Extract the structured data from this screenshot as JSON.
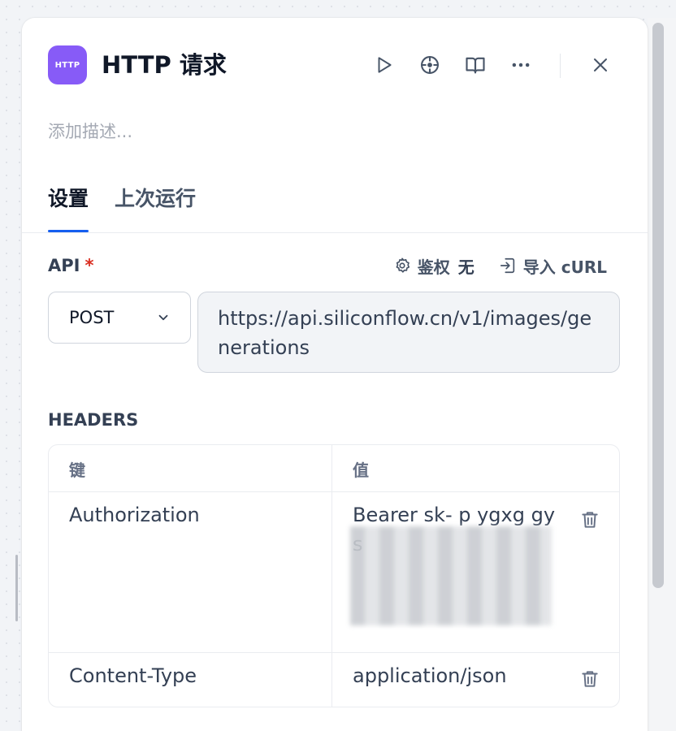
{
  "node": {
    "icon_label": "HTTP",
    "title": "HTTP 请求",
    "description_placeholder": "添加描述..."
  },
  "header_actions": [
    "play-icon",
    "locate-icon",
    "book-open-icon",
    "more-icon",
    "close-icon"
  ],
  "tabs": [
    {
      "label": "设置",
      "active": true
    },
    {
      "label": "上次运行",
      "active": false
    }
  ],
  "api": {
    "label": "API",
    "required_mark": "*",
    "auth_label": "鉴权",
    "auth_value": "无",
    "import_label": "导入 cURL",
    "method": "POST",
    "url": "https://api.siliconflow.cn/v1/images/generations"
  },
  "headers": {
    "label": "HEADERS",
    "columns": {
      "key": "键",
      "value": "值"
    },
    "rows": [
      {
        "key": "Authorization",
        "value": "Bearer sk-                 p                        ygxg      gys"
      },
      {
        "key": "Content-Type",
        "value": "application/json"
      }
    ]
  },
  "colors": {
    "accent": "#155eef",
    "node_icon_bg": "#875bf7",
    "required": "#d92d20"
  }
}
